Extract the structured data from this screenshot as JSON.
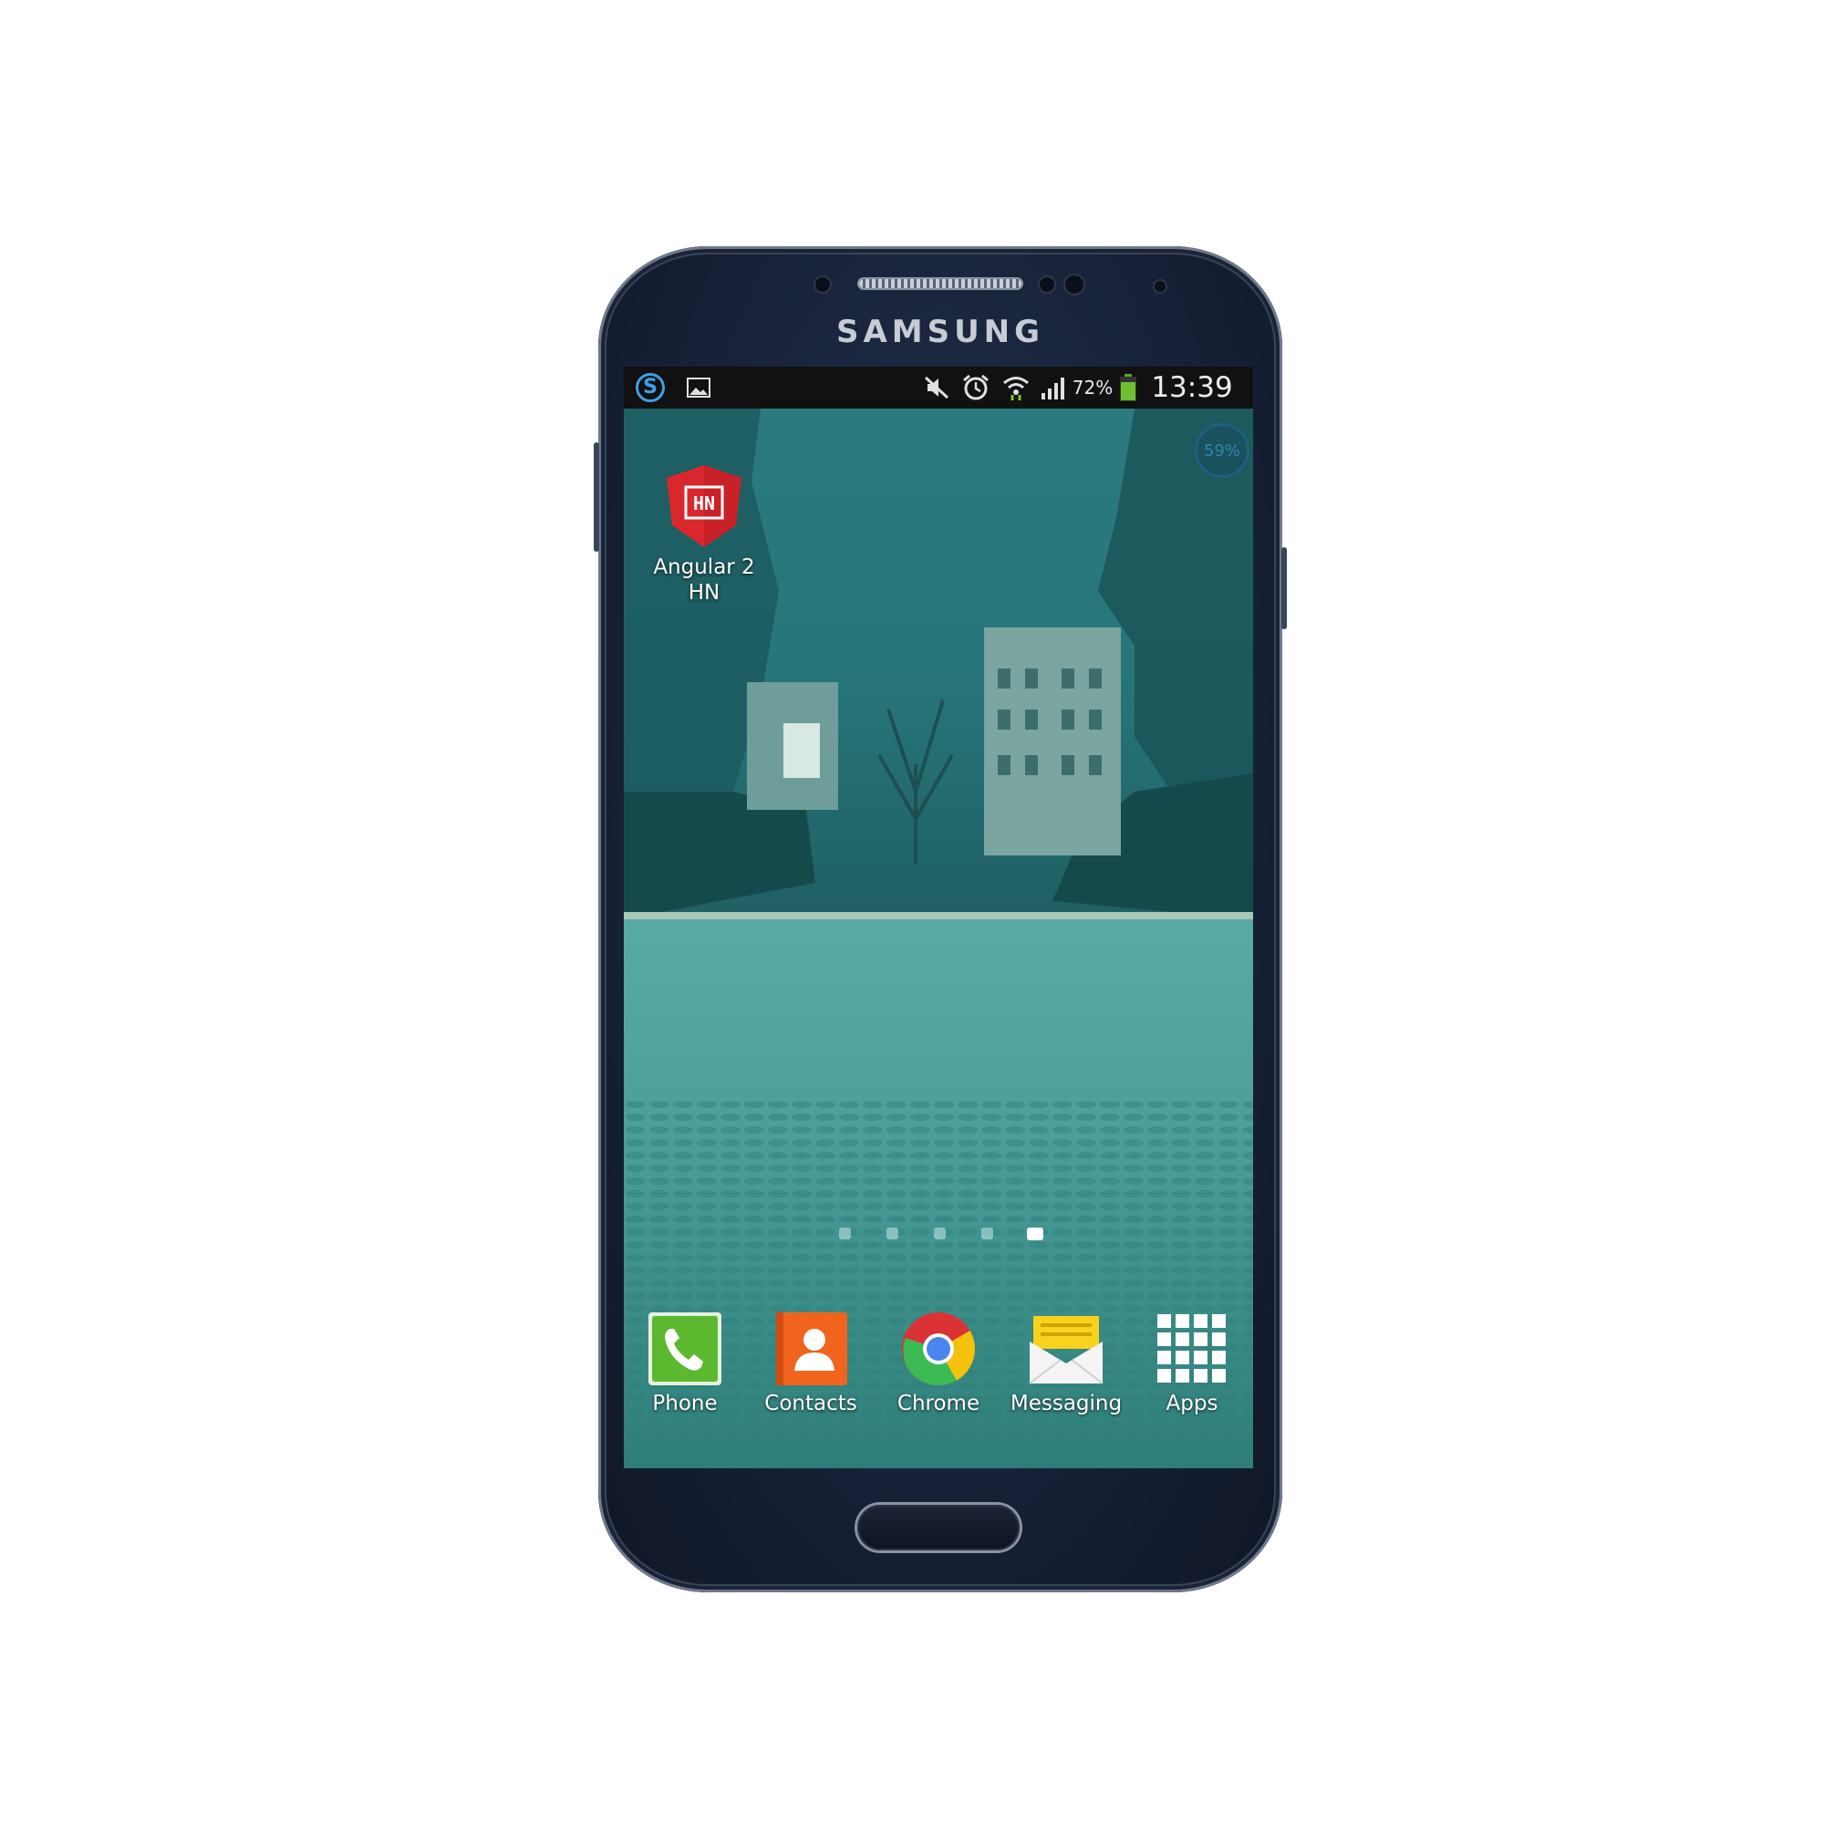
{
  "device": {
    "brand": "SAMSUNG"
  },
  "status_bar": {
    "left_icons": [
      "s-badge-icon",
      "image-icon"
    ],
    "right_icons": [
      "mute-icon",
      "alarm-icon",
      "wifi-icon",
      "signal-icon",
      "battery-icon"
    ],
    "battery_percent": "72%",
    "time": "13:39"
  },
  "widget": {
    "value": "59%"
  },
  "home_shortcut": {
    "label_line1": "Angular 2",
    "label_line2": "HN",
    "logo_text": "HN",
    "color": "#e8262c"
  },
  "page_indicator": {
    "count": 5,
    "active_index": 4
  },
  "dock": {
    "phone": "Phone",
    "contacts": "Contacts",
    "chrome": "Chrome",
    "messaging": "Messaging",
    "apps": "Apps"
  },
  "colors": {
    "statusbar": "#111111",
    "accent_blue": "#3ea0e6",
    "phone_green": "#5cb82e",
    "contacts_orange": "#f0641e"
  }
}
